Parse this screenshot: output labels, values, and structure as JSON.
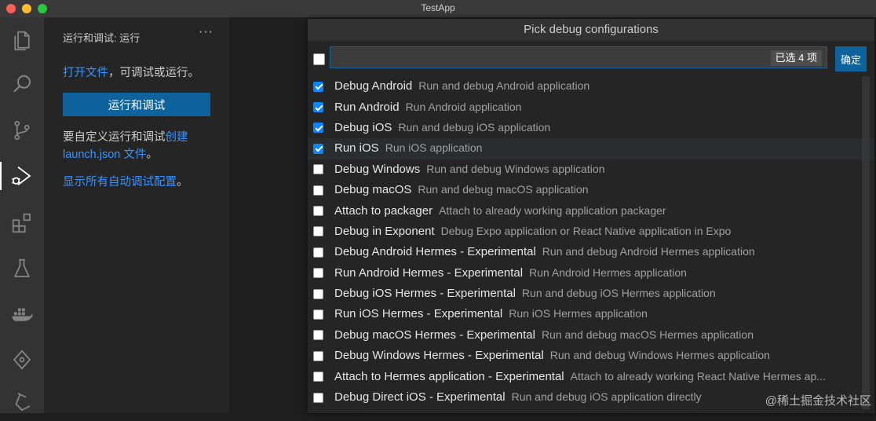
{
  "window": {
    "title": "TestApp"
  },
  "activity_bar": {
    "items": [
      {
        "name": "explorer-icon"
      },
      {
        "name": "search-icon"
      },
      {
        "name": "source-control-icon"
      },
      {
        "name": "run-debug-icon",
        "active": true
      },
      {
        "name": "extensions-icon"
      },
      {
        "name": "testing-icon"
      },
      {
        "name": "docker-icon"
      },
      {
        "name": "gitlens-icon"
      },
      {
        "name": "flask-icon"
      }
    ]
  },
  "sidebar": {
    "header": "运行和调试: 运行",
    "more": "···",
    "open_file_link": "打开文件",
    "open_file_suffix": "，可调试或运行。",
    "run_button": "运行和调试",
    "customize_text": "要自定义运行和调试",
    "create_link": "创建 launch.json 文件",
    "customize_suffix": "。",
    "show_all_link": "显示所有自动调试配置",
    "show_all_suffix": "。"
  },
  "quick_pick": {
    "title": "Pick debug configurations",
    "input_value": "",
    "selected_count": "已选 4 项",
    "ok_button": "确定",
    "items": [
      {
        "label": "Debug Android",
        "description": "Run and debug Android application",
        "checked": true
      },
      {
        "label": "Run Android",
        "description": "Run Android application",
        "checked": true
      },
      {
        "label": "Debug iOS",
        "description": "Run and debug iOS application",
        "checked": true
      },
      {
        "label": "Run iOS",
        "description": "Run iOS application",
        "checked": true,
        "focused": true
      },
      {
        "label": "Debug Windows",
        "description": "Run and debug Windows application",
        "checked": false
      },
      {
        "label": "Debug macOS",
        "description": "Run and debug macOS application",
        "checked": false
      },
      {
        "label": "Attach to packager",
        "description": "Attach to already working application packager",
        "checked": false
      },
      {
        "label": "Debug in Exponent",
        "description": "Debug Expo application or React Native application in Expo",
        "checked": false
      },
      {
        "label": "Debug Android Hermes - Experimental",
        "description": "Run and debug Android Hermes application",
        "checked": false
      },
      {
        "label": "Run Android Hermes - Experimental",
        "description": "Run Android Hermes application",
        "checked": false
      },
      {
        "label": "Debug iOS Hermes - Experimental",
        "description": "Run and debug iOS Hermes application",
        "checked": false
      },
      {
        "label": "Run iOS Hermes - Experimental",
        "description": "Run iOS Hermes application",
        "checked": false
      },
      {
        "label": "Debug macOS Hermes - Experimental",
        "description": "Run and debug macOS Hermes application",
        "checked": false
      },
      {
        "label": "Debug Windows Hermes - Experimental",
        "description": "Run and debug Windows Hermes application",
        "checked": false
      },
      {
        "label": "Attach to Hermes application - Experimental",
        "description": "Attach to already working React Native Hermes ap...",
        "checked": false
      },
      {
        "label": "Debug Direct iOS - Experimental",
        "description": "Run and debug iOS application directly",
        "checked": false
      }
    ]
  },
  "watermark": "@稀土掘金技术社区",
  "colors": {
    "accent": "#0e639c",
    "link": "#3794ff",
    "checkbox": "#0a84ff"
  }
}
